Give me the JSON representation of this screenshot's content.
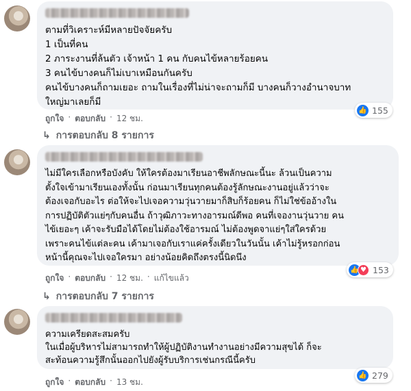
{
  "comments": [
    {
      "text": "ตามที่วิเคราะห์มีหลายปัจจัยครับ\n1 เป็นที่คน\n2 ภาระงานที่ล้นตัว เจ้าหน้า 1 คน กับคนไข้หลายร้อยคน\n3 คนไข้บางคนก็ไม่เบาเหมือนกันครับ\nคนไข้บางคนก็ถามเยอะ ถามในเรื่องที่ไม่น่าจะถามก็มี บางคนก็วางอำนาจบาท\nใหญ่มาเลยก็มี",
      "reaction_count": "155",
      "like_label": "ถูกใจ",
      "reply_label": "ตอบกลับ",
      "time": "12 ชม.",
      "replies_label": "การตอบกลับ 8 รายการ"
    },
    {
      "text": "ไม่มีใครเลือกหรือบังคับ ให้ใครต้องมาเรียนอาชีพลักษณะนี้นะ ล้วนเป็นความ\nตั้งใจเข้ามาเรียนเองทั้งนั้น ก่อนมาเรียนทุกคนต้องรู้ลักษณะงานอยู่แล้วว่าจะ\nต้องเจอกับอะไร ต่อให้จะไปเจอความวุ่นวายมาก็สิบก็ร้อยคน ก็ไม่ใช่ข้ออ้างใน\nการปฏิบัติตัวแย่ๆกับคนอื่น ถ้าวุฒิภาวะทางอารมณ์ดีพอ คนที่เจองานวุ่นวาย คน\nไข้เยอะๆ เค้าจะรับมือได้โดยไม่ต้องใช้อารมณ์ ไม่ต้องพูดจาแย่ๆใส่ใครด้วย\nเพราะคนไข้แต่ละคน เค้ามาเจอกับเราแค่ครั้งเดียวในวันนั้น เค้าไม่รู้หรอกก่อน\nหน้านี้คุณจะไปเจอใครมา อย่างน้อยคิดถึงตรงนี้นิดนึง",
      "reaction_count": "153",
      "like_label": "ถูกใจ",
      "reply_label": "ตอบกลับ",
      "time": "12 ชม.",
      "edited_label": "แก้ไขแล้ว",
      "replies_label": "การตอบกลับ 7 รายการ"
    },
    {
      "text": "ความเครียดสะสมครับ\nในเมื่อผู้บริหารไม่สามารถทำให้ผู้ปฏิบัติงานทำงานอย่างมีความสุขได้ ก็จะ\nสะท้อนความรู้สึกนั้นออกไปยังผู้รับบริการเช่นกรณีนี้ครับ",
      "reaction_count": "279",
      "like_label": "ถูกใจ",
      "reply_label": "ตอบกลับ",
      "time": "13 ชม."
    }
  ],
  "icons": {
    "like": "like-icon",
    "love": "love-icon",
    "reply_arrow": "reply-arrow-icon"
  },
  "colors": {
    "bubble": "#f0f2f5",
    "like_blue": "#1877f2",
    "love_red": "#f33e58",
    "meta_gray": "#65676b"
  }
}
